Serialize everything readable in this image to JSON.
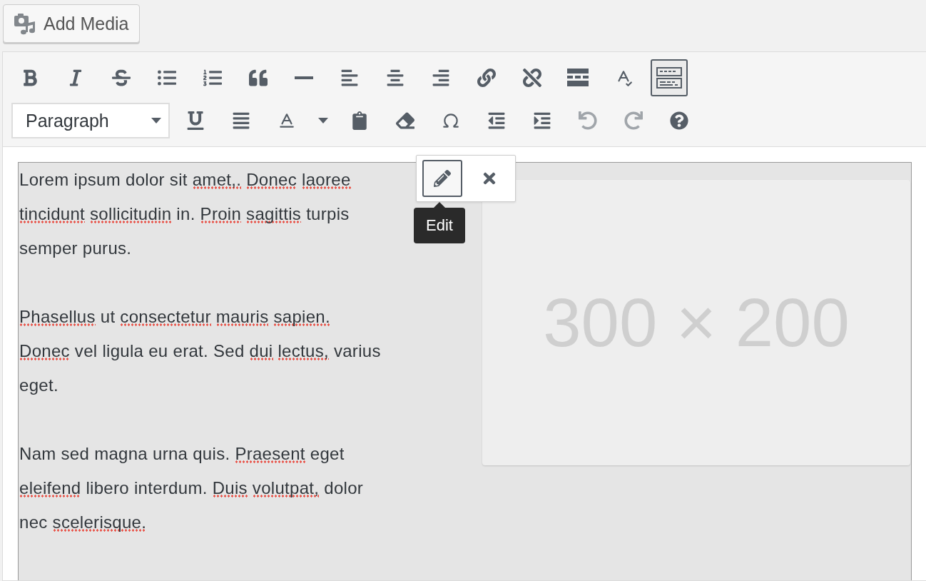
{
  "add_media_button": {
    "label": "Add Media"
  },
  "toolbar": {
    "rows": [
      [
        {
          "kind": "bold",
          "active": false,
          "disabled": false
        },
        {
          "kind": "italic",
          "active": false,
          "disabled": false
        },
        {
          "kind": "strikethrough",
          "active": false,
          "disabled": false
        },
        {
          "kind": "bullet-list",
          "active": false,
          "disabled": false
        },
        {
          "kind": "numbered-list",
          "active": false,
          "disabled": false
        },
        {
          "kind": "quote",
          "active": false,
          "disabled": false
        },
        {
          "kind": "horizontal-line",
          "active": false,
          "disabled": false
        },
        {
          "kind": "align-left",
          "active": false,
          "disabled": false
        },
        {
          "kind": "align-center",
          "active": false,
          "disabled": false
        },
        {
          "kind": "align-right",
          "active": false,
          "disabled": false
        },
        {
          "kind": "link",
          "active": false,
          "disabled": false
        },
        {
          "kind": "unlink",
          "active": false,
          "disabled": false
        },
        {
          "kind": "read-more",
          "active": false,
          "disabled": false
        },
        {
          "kind": "spellcheck",
          "active": false,
          "disabled": false
        },
        {
          "kind": "toolbar-toggle",
          "active": true,
          "disabled": false
        }
      ],
      [
        {
          "kind": "format-select",
          "value": "Paragraph"
        },
        {
          "kind": "underline",
          "active": false,
          "disabled": false
        },
        {
          "kind": "justify",
          "active": false,
          "disabled": false
        },
        {
          "kind": "text-color",
          "active": false,
          "disabled": false
        },
        {
          "kind": "paste-text",
          "active": false,
          "disabled": false
        },
        {
          "kind": "clear-formatting",
          "active": false,
          "disabled": false
        },
        {
          "kind": "special-character",
          "active": false,
          "disabled": false
        },
        {
          "kind": "outdent",
          "active": false,
          "disabled": false
        },
        {
          "kind": "indent",
          "active": false,
          "disabled": false
        },
        {
          "kind": "undo",
          "active": false,
          "disabled": true
        },
        {
          "kind": "redo",
          "active": false,
          "disabled": true
        },
        {
          "kind": "help",
          "active": false,
          "disabled": false
        }
      ]
    ]
  },
  "content": {
    "paragraphs": [
      {
        "lines": [
          [
            {
              "text": "Lorem",
              "misspelled": false
            },
            {
              "text": "ipsum",
              "misspelled": false
            },
            {
              "text": "dolor",
              "misspelled": false
            },
            {
              "text": "sit",
              "misspelled": false
            },
            {
              "text": "amet,.",
              "misspelled": true
            },
            {
              "text": "Donec",
              "misspelled": true
            },
            {
              "text": "laoree",
              "misspelled": true
            }
          ],
          [
            {
              "text": "tincidunt",
              "misspelled": true
            },
            {
              "text": "sollicitudin",
              "misspelled": true
            },
            {
              "text": "in.",
              "misspelled": false
            },
            {
              "text": "Proin",
              "misspelled": true
            },
            {
              "text": "sagittis",
              "misspelled": true
            },
            {
              "text": "turpis",
              "misspelled": false
            }
          ],
          [
            {
              "text": "semper",
              "misspelled": false
            },
            {
              "text": "purus.",
              "misspelled": false
            }
          ]
        ]
      },
      {
        "lines": [
          [
            {
              "text": "Phasellus",
              "misspelled": true
            },
            {
              "text": "ut",
              "misspelled": false
            },
            {
              "text": "consectetur",
              "misspelled": true
            },
            {
              "text": "mauris",
              "misspelled": true
            },
            {
              "text": "sapien.",
              "misspelled": true
            }
          ],
          [
            {
              "text": "Donec",
              "misspelled": true
            },
            {
              "text": "vel",
              "misspelled": false
            },
            {
              "text": "ligula",
              "misspelled": false
            },
            {
              "text": "eu",
              "misspelled": false
            },
            {
              "text": "erat.",
              "misspelled": false
            },
            {
              "text": "Sed",
              "misspelled": false
            },
            {
              "text": "dui",
              "misspelled": true
            },
            {
              "text": "lectus,",
              "misspelled": true
            },
            {
              "text": "varius",
              "misspelled": false
            }
          ],
          [
            {
              "text": "eget.",
              "misspelled": false
            }
          ]
        ]
      },
      {
        "lines": [
          [
            {
              "text": "Nam",
              "misspelled": false
            },
            {
              "text": "sed",
              "misspelled": false
            },
            {
              "text": "magna",
              "misspelled": false
            },
            {
              "text": "urna",
              "misspelled": false
            },
            {
              "text": "quis.",
              "misspelled": false
            },
            {
              "text": "Praesent",
              "misspelled": true
            },
            {
              "text": "eget",
              "misspelled": false
            }
          ],
          [
            {
              "text": "eleifend",
              "misspelled": true
            },
            {
              "text": "libero",
              "misspelled": false
            },
            {
              "text": "interdum.",
              "misspelled": false
            },
            {
              "text": "Duis",
              "misspelled": true
            },
            {
              "text": "volutpat,",
              "misspelled": true
            },
            {
              "text": "dolor",
              "misspelled": false
            }
          ],
          [
            {
              "text": "nec",
              "misspelled": false
            },
            {
              "text": "scelerisque.",
              "misspelled": true
            }
          ]
        ]
      }
    ],
    "selected": true,
    "image": {
      "placeholder": "300 × 200"
    }
  },
  "image_toolbar": {
    "buttons": [
      {
        "kind": "edit",
        "active": true
      },
      {
        "kind": "remove",
        "active": false
      }
    ]
  },
  "tooltip": {
    "text": "Edit"
  }
}
